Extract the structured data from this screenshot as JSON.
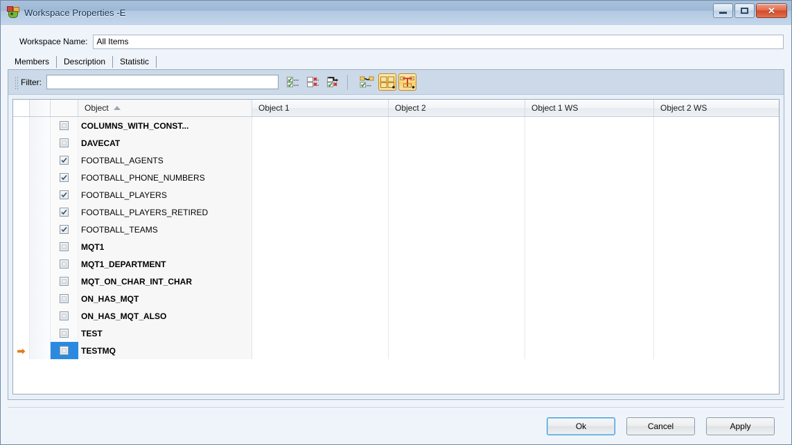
{
  "window": {
    "title": "Workspace Properties -E",
    "icon": "workspace-properties-icon",
    "controls": {
      "minimize": "minimize-icon",
      "maximize": "maximize-icon",
      "close": "close-icon"
    }
  },
  "workspace": {
    "name_label": "Workspace Name:",
    "name_value": "All Items",
    "name_placeholder": ""
  },
  "tabs": [
    {
      "label": "Members",
      "active": true
    },
    {
      "label": "Description",
      "active": false
    },
    {
      "label": "Statistic",
      "active": false
    }
  ],
  "toolbar": {
    "grip": "drag-grip-icon",
    "filter_label": "Filter:",
    "filter_value": "",
    "filter_placeholder": "",
    "buttons": [
      {
        "name": "check-all-button",
        "icon": "check-all-icon",
        "pressed": false
      },
      {
        "name": "uncheck-all-button",
        "icon": "uncheck-all-icon",
        "pressed": false
      },
      {
        "name": "invert-selection-button",
        "icon": "invert-selection-icon",
        "pressed": false
      },
      {
        "name": "select-dependencies-button",
        "icon": "dependencies-icon",
        "pressed": false
      },
      {
        "name": "group-objects-button",
        "icon": "group-objects-icon",
        "pressed": true
      },
      {
        "name": "show-hierarchy-button",
        "icon": "hierarchy-icon",
        "pressed": true
      }
    ]
  },
  "grid": {
    "columns": [
      {
        "key": "gutter1",
        "label": ""
      },
      {
        "key": "gutter2",
        "label": ""
      },
      {
        "key": "checkbox",
        "label": ""
      },
      {
        "key": "object",
        "label": "Object",
        "sort": "asc"
      },
      {
        "key": "object1",
        "label": "Object 1"
      },
      {
        "key": "object2",
        "label": "Object 2"
      },
      {
        "key": "object1ws",
        "label": "Object 1 WS"
      },
      {
        "key": "object2ws",
        "label": "Object 2 WS"
      }
    ],
    "rows": [
      {
        "object": "COLUMNS_WITH_CONST...",
        "checked": false,
        "bold": true,
        "current": false,
        "object1": "",
        "object2": "",
        "object1ws": "",
        "object2ws": ""
      },
      {
        "object": "DAVECAT",
        "checked": false,
        "bold": true,
        "current": false,
        "object1": "",
        "object2": "",
        "object1ws": "",
        "object2ws": ""
      },
      {
        "object": "FOOTBALL_AGENTS",
        "checked": true,
        "bold": false,
        "current": false,
        "object1": "",
        "object2": "",
        "object1ws": "",
        "object2ws": ""
      },
      {
        "object": "FOOTBALL_PHONE_NUMBERS",
        "checked": true,
        "bold": false,
        "current": false,
        "object1": "",
        "object2": "",
        "object1ws": "",
        "object2ws": ""
      },
      {
        "object": "FOOTBALL_PLAYERS",
        "checked": true,
        "bold": false,
        "current": false,
        "object1": "",
        "object2": "",
        "object1ws": "",
        "object2ws": ""
      },
      {
        "object": "FOOTBALL_PLAYERS_RETIRED",
        "checked": true,
        "bold": false,
        "current": false,
        "object1": "",
        "object2": "",
        "object1ws": "",
        "object2ws": ""
      },
      {
        "object": "FOOTBALL_TEAMS",
        "checked": true,
        "bold": false,
        "current": false,
        "object1": "",
        "object2": "",
        "object1ws": "",
        "object2ws": ""
      },
      {
        "object": "MQT1",
        "checked": false,
        "bold": true,
        "current": false,
        "object1": "",
        "object2": "",
        "object1ws": "",
        "object2ws": ""
      },
      {
        "object": "MQT1_DEPARTMENT",
        "checked": false,
        "bold": true,
        "current": false,
        "object1": "",
        "object2": "",
        "object1ws": "",
        "object2ws": ""
      },
      {
        "object": "MQT_ON_CHAR_INT_CHAR",
        "checked": false,
        "bold": true,
        "current": false,
        "object1": "",
        "object2": "",
        "object1ws": "",
        "object2ws": ""
      },
      {
        "object": "ON_HAS_MQT",
        "checked": false,
        "bold": true,
        "current": false,
        "object1": "",
        "object2": "",
        "object1ws": "",
        "object2ws": ""
      },
      {
        "object": "ON_HAS_MQT_ALSO",
        "checked": false,
        "bold": true,
        "current": false,
        "object1": "",
        "object2": "",
        "object1ws": "",
        "object2ws": ""
      },
      {
        "object": "TEST",
        "checked": false,
        "bold": true,
        "current": false,
        "object1": "",
        "object2": "",
        "object1ws": "",
        "object2ws": ""
      },
      {
        "object": "TESTMQ",
        "checked": false,
        "bold": true,
        "current": true,
        "object1": "",
        "object2": "",
        "object1ws": "",
        "object2ws": ""
      }
    ],
    "current_row_marker": "row-current-arrow-icon"
  },
  "footer": {
    "ok": "Ok",
    "cancel": "Cancel",
    "apply": "Apply"
  },
  "colors": {
    "titlebar_top": "#a8c0da",
    "body": "#eff4fb",
    "toolbar": "#cbd9e8",
    "selection_blue": "#2b8adf",
    "current_arrow_orange": "#e07b18",
    "toggle_amber": "#f9cd6a",
    "default_button_focus": "#3e9ad6"
  }
}
